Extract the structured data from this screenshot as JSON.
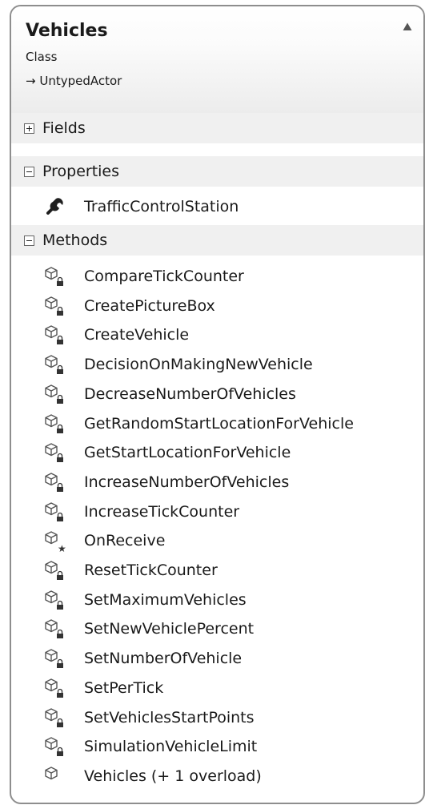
{
  "class": {
    "name": "Vehicles",
    "kind": "Class",
    "base": "→ UntypedActor"
  },
  "sections": {
    "fields": {
      "label": "Fields",
      "expanded": false
    },
    "properties": {
      "label": "Properties",
      "expanded": true
    },
    "methods": {
      "label": "Methods",
      "expanded": true
    }
  },
  "properties": [
    {
      "name": "TrafficControlStation",
      "icon": "wrench-icon"
    }
  ],
  "methods": [
    {
      "name": "CompareTickCounter",
      "icon": "private-method-icon"
    },
    {
      "name": "CreatePictureBox",
      "icon": "private-method-icon"
    },
    {
      "name": "CreateVehicle",
      "icon": "private-method-icon"
    },
    {
      "name": "DecisionOnMakingNewVehicle",
      "icon": "private-method-icon"
    },
    {
      "name": "DecreaseNumberOfVehicles",
      "icon": "private-method-icon"
    },
    {
      "name": "GetRandomStartLocationForVehicle",
      "icon": "private-method-icon"
    },
    {
      "name": "GetStartLocationForVehicle",
      "icon": "private-method-icon"
    },
    {
      "name": "IncreaseNumberOfVehicles",
      "icon": "private-method-icon"
    },
    {
      "name": "IncreaseTickCounter",
      "icon": "private-method-icon"
    },
    {
      "name": "OnReceive",
      "icon": "protected-method-icon"
    },
    {
      "name": "ResetTickCounter",
      "icon": "private-method-icon"
    },
    {
      "name": "SetMaximumVehicles",
      "icon": "private-method-icon"
    },
    {
      "name": "SetNewVehiclePercent",
      "icon": "private-method-icon"
    },
    {
      "name": "SetNumberOfVehicle",
      "icon": "private-method-icon"
    },
    {
      "name": "SetPerTick",
      "icon": "private-method-icon"
    },
    {
      "name": "SetVehiclesStartPoints",
      "icon": "private-method-icon"
    },
    {
      "name": "SimulationVehicleLimit",
      "icon": "private-method-icon"
    },
    {
      "name": "Vehicles (+ 1 overload)",
      "icon": "public-method-icon"
    }
  ]
}
